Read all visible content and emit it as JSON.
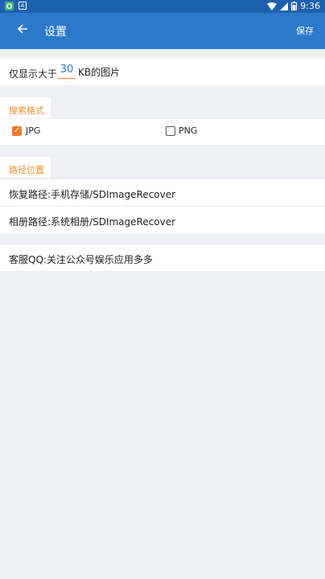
{
  "status_bar": {
    "time": "9:36",
    "icons": [
      "app-icon",
      "notification-icon",
      "wifi-icon",
      "signal-icon",
      "battery-icon"
    ]
  },
  "app_bar": {
    "title": "设置",
    "save_label": "保存",
    "back_icon": "arrow-left-icon"
  },
  "min_size": {
    "prefix": "仅显示大于",
    "value": "30",
    "suffix": "KB的图片"
  },
  "search_format": {
    "header": "搜索格式",
    "options": [
      {
        "label": "JPG",
        "checked": true
      },
      {
        "label": "PNG",
        "checked": false
      }
    ]
  },
  "paths": {
    "header": "路径位置",
    "recover": "恢复路径:手机存储/SDImageRecover",
    "album": "相册路径:系统相册/SDImageRecover"
  },
  "support": {
    "text": "客服QQ:关注公众号娱乐应用多多"
  },
  "colors": {
    "appbar": "#2c79cc",
    "statusbar": "#1e60b0",
    "accent": "#f0782a",
    "section_text": "#f0902a"
  }
}
